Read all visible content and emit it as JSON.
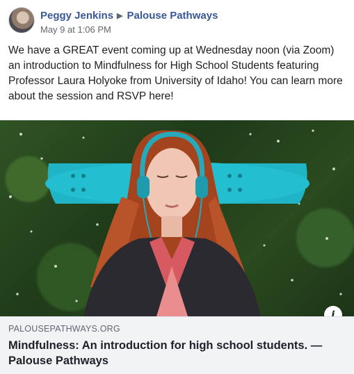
{
  "post": {
    "author": "Peggy Jenkins",
    "group": "Palouse Pathways",
    "timestamp": "May 9 at 1:06 PM",
    "text": "We have a GREAT event coming up at Wednesday noon (via Zoom) an introduction to Mindfulness for High School Students featuring Professor Laura Holyoke from University of Idaho! You can learn more about the session and RSVP here!"
  },
  "link_preview": {
    "domain": "PALOUSEPATHWAYS.ORG",
    "title": "Mindfulness: An introduction for high school students. — Palouse Pathways",
    "info_icon": "i"
  },
  "colors": {
    "link_blue": "#385898",
    "text": "#1c1e21",
    "meta_gray": "#616770",
    "preview_bg": "#f2f3f5",
    "skateboard_teal": "#1fb4c6"
  },
  "icons": {
    "group_arrow": "right-triangle-icon",
    "info": "info-icon"
  }
}
